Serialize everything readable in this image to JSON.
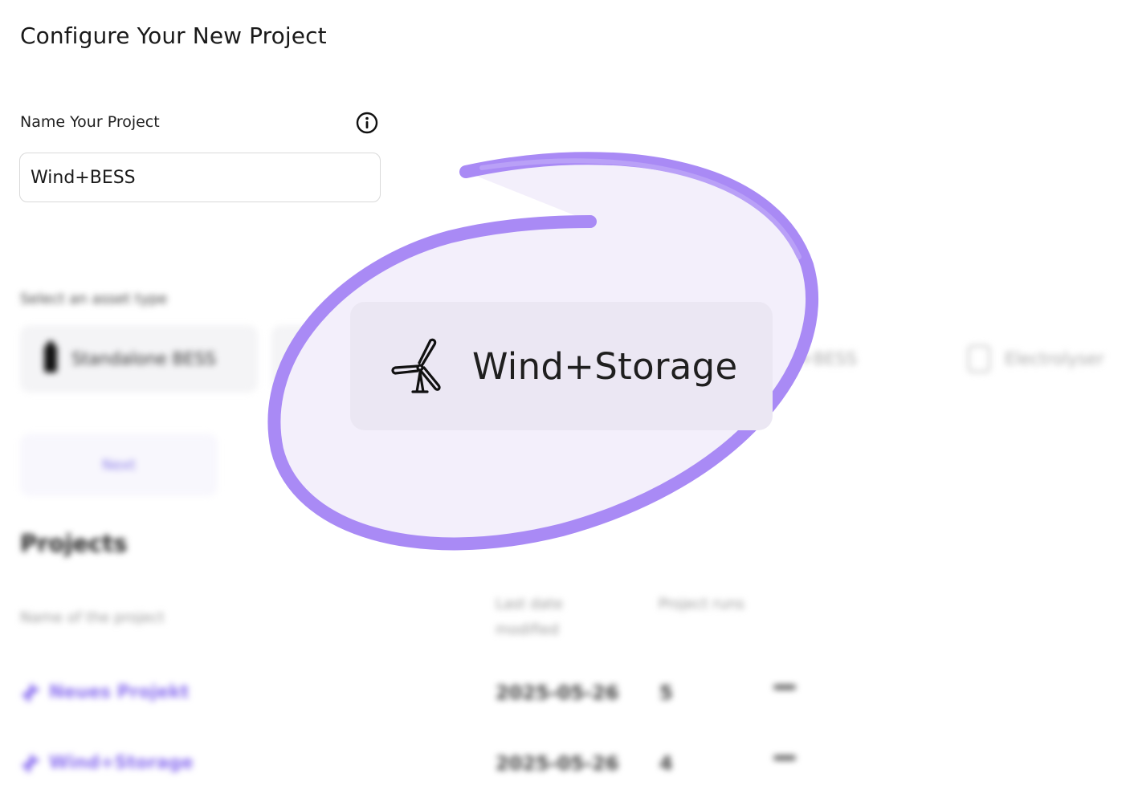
{
  "header": {
    "title": "Configure Your New Project"
  },
  "form": {
    "name_label": "Name Your Project",
    "name_value": "Wind+BESS",
    "info_icon": "info-icon"
  },
  "asset_types": {
    "label": "Select an asset type",
    "items": [
      {
        "label": "Standalone BESS",
        "icon": "battery-icon"
      },
      {
        "label": "Wind+Storage",
        "icon": "wind-turbine-icon",
        "selected": true
      },
      {
        "label": "...+BESS",
        "icon": ""
      },
      {
        "label": "Electrolyser",
        "icon": "electrolyser-icon"
      }
    ]
  },
  "actions": {
    "next_label": "Next"
  },
  "projects": {
    "heading": "Projects",
    "columns": [
      "Name of the project",
      "Last date modified",
      "Project runs"
    ],
    "rows": [
      {
        "name": "Neues Projekt",
        "date": "2025-05-26",
        "runs": "5"
      },
      {
        "name": "Wind+Storage",
        "date": "2025-05-26",
        "runs": "4"
      }
    ]
  },
  "colors": {
    "accent": "#9b7bf0",
    "highlight_fill": "#f3effb",
    "selected_card": "#ebe7f3"
  }
}
